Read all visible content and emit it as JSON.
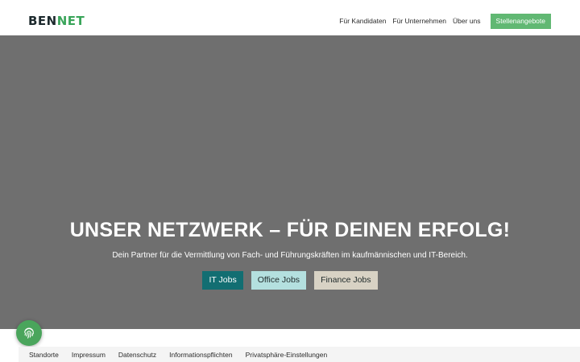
{
  "header": {
    "logo": {
      "part1": "BEN",
      "part2": "NET"
    },
    "nav": [
      {
        "label": "Für Kandidaten"
      },
      {
        "label": "Für Unternehmen"
      },
      {
        "label": "Über uns"
      }
    ],
    "cta_label": "Stellenangebote"
  },
  "hero": {
    "title": "UNSER NETZWERK – FÜR DEINEN ERFOLG!",
    "subtitle": "Dein Partner für die Vermittlung von Fach- und Führungskräften im kaufmännischen und IT-Bereich.",
    "buttons": [
      {
        "label": "IT Jobs"
      },
      {
        "label": "Office Jobs"
      },
      {
        "label": "Finance Jobs"
      }
    ]
  },
  "privacy_button": {
    "icon": "fingerprint-icon"
  },
  "footer": {
    "links": [
      {
        "label": "Standorte"
      },
      {
        "label": "Impressum"
      },
      {
        "label": "Datenschutz"
      },
      {
        "label": "Informationspflichten"
      },
      {
        "label": "Privatsphäre-Einstellungen"
      }
    ]
  },
  "colors": {
    "brand_green": "#61b873",
    "hero_background": "#6f6f6f",
    "it_button": "#126e72",
    "office_button": "#b4e0df",
    "finance_button": "#d8d2c4",
    "logo_dark": "#1d2a2e",
    "logo_accent": "#3aa55a"
  }
}
